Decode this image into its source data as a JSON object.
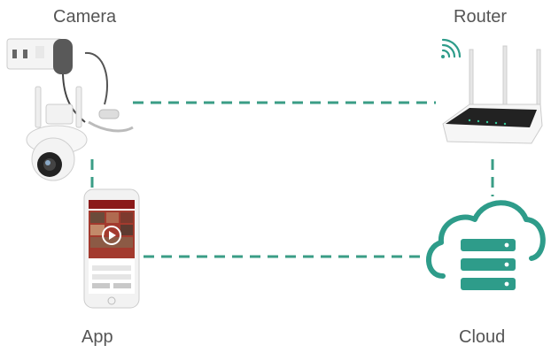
{
  "labels": {
    "camera": "Camera",
    "router": "Router",
    "app": "App",
    "cloud": "Cloud"
  },
  "icons": {
    "camera": "security-camera-icon",
    "router": "wifi-router-icon",
    "app": "smartphone-app-icon",
    "cloud": "cloud-server-icon",
    "wifi": "wifi-signal-icon"
  },
  "colors": {
    "connector": "#3a9d86",
    "accent": "#2e9c8a",
    "label": "#555555",
    "app_theme": "#8b1a1a"
  }
}
